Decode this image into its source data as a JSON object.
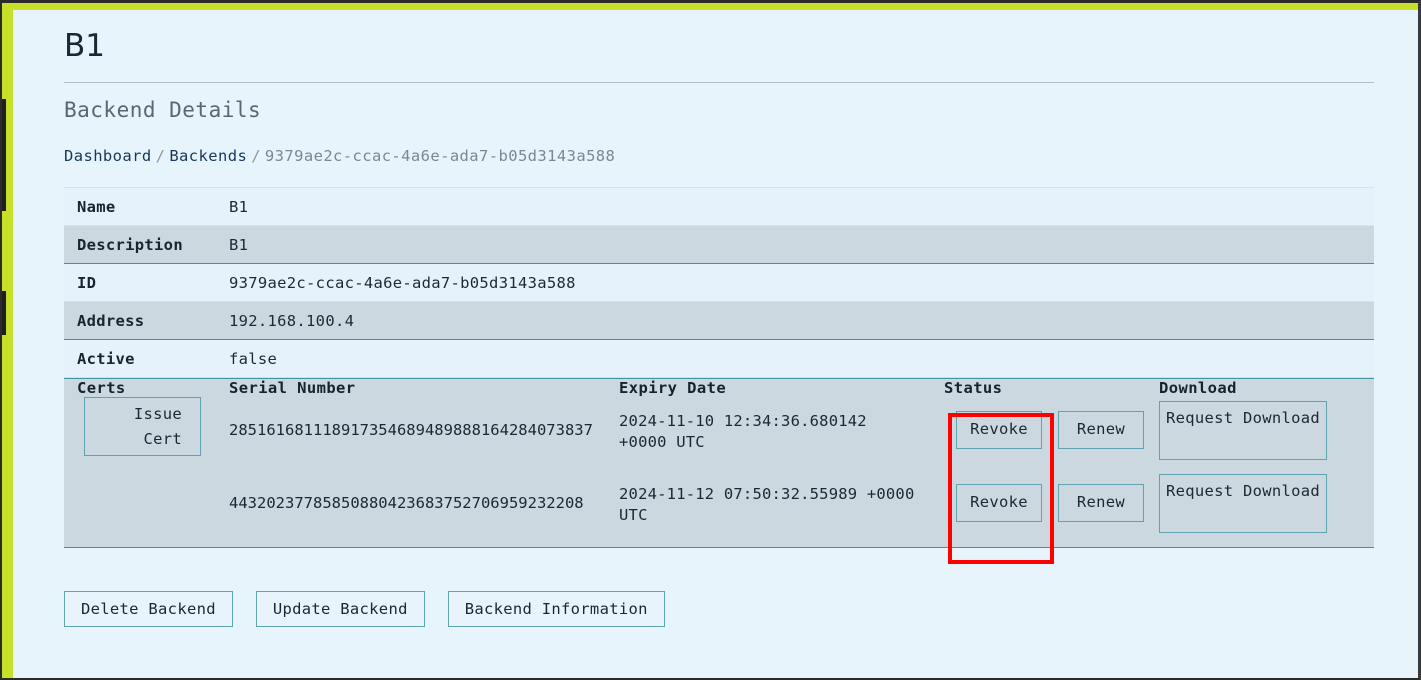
{
  "window": {
    "accent_lime": "#c9e02a",
    "page_background": "#e8f4fc",
    "annotation_color": "#ff0000"
  },
  "header": {
    "title": "B1",
    "section_heading": "Backend Details"
  },
  "breadcrumb": {
    "dashboard": "Dashboard",
    "backends": "Backends",
    "separator": "/",
    "current": "9379ae2c-ccac-4a6e-ada7-b05d3143a588"
  },
  "details": {
    "rows": [
      {
        "label": "Name",
        "value": "B1"
      },
      {
        "label": "Description",
        "value": "B1"
      },
      {
        "label": "ID",
        "value": "9379ae2c-ccac-4a6e-ada7-b05d3143a588"
      },
      {
        "label": "Address",
        "value": "192.168.100.4"
      },
      {
        "label": "Active",
        "value": "false"
      }
    ]
  },
  "certs": {
    "label": "Certs",
    "issue_cert_label": "Issue\nCert",
    "headers": {
      "serial": "Serial Number",
      "expiry": "Expiry Date",
      "status": "Status",
      "download": "Download"
    },
    "rows": [
      {
        "serial": "285161681118917354689489888164284073837",
        "expiry": "2024-11-10 12:34:36.680142 +0000 UTC",
        "revoke_label": "Revoke",
        "renew_label": "Renew",
        "download_label": "Request Download"
      },
      {
        "serial": "44320237785850880423683752706959232208",
        "expiry": "2024-11-12 07:50:32.55989 +0000 UTC",
        "revoke_label": "Revoke",
        "renew_label": "Renew",
        "download_label": "Request Download"
      }
    ]
  },
  "actions": {
    "delete": "Delete Backend",
    "update": "Update Backend",
    "information": "Backend Information"
  }
}
